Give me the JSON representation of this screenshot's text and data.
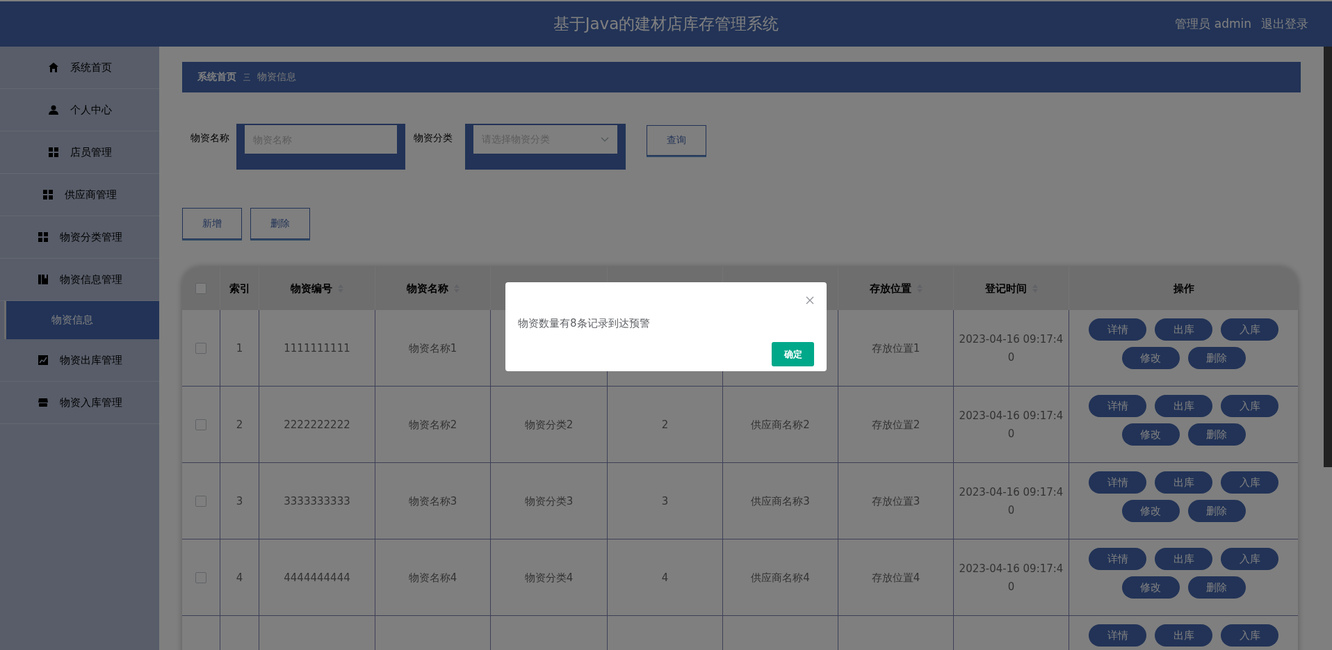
{
  "header": {
    "title": "基于Java的建材店库存管理系统",
    "user": "管理员 admin",
    "logout": "退出登录"
  },
  "sidebar": {
    "items": [
      {
        "label": "系统首页",
        "selected": false
      },
      {
        "label": "个人中心",
        "selected": false
      },
      {
        "label": "店员管理",
        "selected": false
      },
      {
        "label": "供应商管理",
        "selected": false
      },
      {
        "label": "物资分类管理",
        "selected": false
      },
      {
        "label": "物资信息管理",
        "selected": false,
        "expanded": true,
        "children": [
          {
            "label": "物资信息",
            "selected": true
          }
        ]
      },
      {
        "label": "物资出库管理",
        "selected": false
      },
      {
        "label": "物资入库管理",
        "selected": false
      }
    ]
  },
  "breadcrumb": [
    "系统首页",
    "物资信息"
  ],
  "search": {
    "name_label": "物资名称",
    "name_placeholder": "物资名称",
    "category_label": "物资分类",
    "category_placeholder": "请选择物资分类",
    "query_button": "查询"
  },
  "actions": [
    "新增",
    "删除"
  ],
  "table": {
    "header": {
      "checked": false,
      "index": {
        "label": "索引",
        "sortable": false
      },
      "code": {
        "label": "物资编号",
        "sortable": true
      },
      "name": {
        "label": "物资名称",
        "sortable": true
      },
      "location": {
        "label": "存放位置",
        "sortable": true
      },
      "time": {
        "label": "登记时间",
        "sortable": true
      },
      "actions": {
        "label": "操作",
        "sortable": false
      }
    },
    "rows": [
      {
        "checked": false,
        "index": "1",
        "code": "1111111111",
        "name": "物资名称1",
        "location": "存放位置1",
        "time": "2023-04-16 09:17:40",
        "actions": [
          "详情",
          "出库",
          "入库",
          "修改",
          "删除"
        ]
      },
      {
        "checked": false,
        "index": "2",
        "code": "2222222222",
        "name": "物资名称2",
        "column_4": "物资分类2",
        "column_5": "2",
        "column_6": "供应商名称2",
        "location": "存放位置2",
        "time": "2023-04-16 09:17:40",
        "actions": [
          "详情",
          "出库",
          "入库",
          "修改",
          "删除"
        ]
      },
      {
        "checked": false,
        "index": "3",
        "code": "3333333333",
        "name": "物资名称3",
        "column_4": "物资分类3",
        "column_5": "3",
        "column_6": "供应商名称3",
        "location": "存放位置3",
        "time": "2023-04-16 09:17:40",
        "actions": [
          "详情",
          "出库",
          "入库",
          "修改",
          "删除"
        ]
      },
      {
        "checked": false,
        "index": "4",
        "code": "4444444444",
        "name": "物资名称4",
        "column_4": "物资分类4",
        "column_5": "4",
        "column_6": "供应商名称4",
        "location": "存放位置4",
        "time": "2023-04-16 09:17:40",
        "actions": [
          "详情",
          "出库",
          "入库",
          "修改",
          "删除"
        ]
      },
      {
        "actions": [
          "详情",
          "出库",
          "入库"
        ]
      }
    ]
  },
  "dialog": {
    "message": "物资数量有8条记录到达预警",
    "confirm": "确定"
  }
}
